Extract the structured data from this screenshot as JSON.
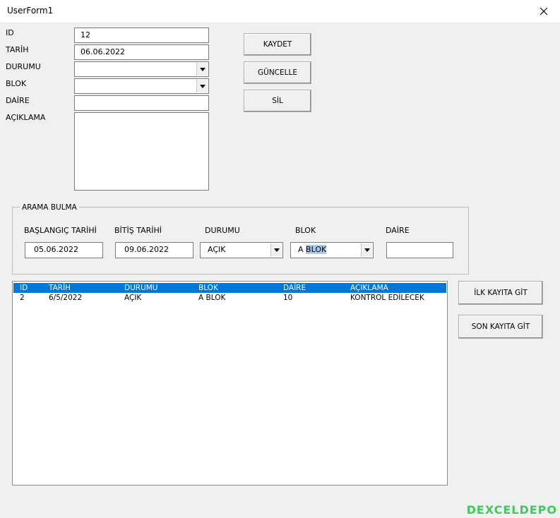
{
  "window": {
    "title": "UserForm1"
  },
  "form": {
    "fields": [
      {
        "label": "ID",
        "value": "12"
      },
      {
        "label": "TARİH",
        "value": "06.06.2022"
      },
      {
        "label": "DURUMU",
        "value": ""
      },
      {
        "label": "BLOK",
        "value": ""
      },
      {
        "label": "DAİRE",
        "value": ""
      },
      {
        "label": "AÇIKLAMA",
        "value": ""
      }
    ]
  },
  "buttons": {
    "kaydet": "KAYDET",
    "guncelle": "GÜNCELLE",
    "sil": "SİL",
    "ilk_kayit": "İLK KAYITA GİT",
    "son_kayit": "SON KAYITA GİT"
  },
  "search": {
    "frame_title": "ARAMA BULMA",
    "labels": {
      "baslangic": "BAŞLANGIÇ TARİHİ",
      "bitis": "BİTİŞ TARİHİ",
      "durumu": "DURUMU",
      "blok": "BLOK",
      "daire": "DAİRE"
    },
    "values": {
      "baslangic": "05.06.2022",
      "bitis": "09.06.2022",
      "durumu": "AÇIK",
      "blok_prefix": "A",
      "blok_selected": "BLOK",
      "daire": ""
    }
  },
  "list": {
    "columns": [
      "ID",
      "TARİH",
      "DURUMU",
      "BLOK",
      "DAİRE",
      "AÇIKLAMA"
    ],
    "rows": [
      [
        "2",
        "6/5/2022",
        "AÇIK",
        "A BLOK",
        "10",
        "KONTROL EDİLECEK"
      ]
    ]
  },
  "watermark": "DEXCELDEPO",
  "icons": [
    "close-icon",
    "dropdown-arrow-icon"
  ],
  "colors": {
    "list_header_bg": "#0078d7",
    "selection_highlight": "#a8cdf0"
  }
}
